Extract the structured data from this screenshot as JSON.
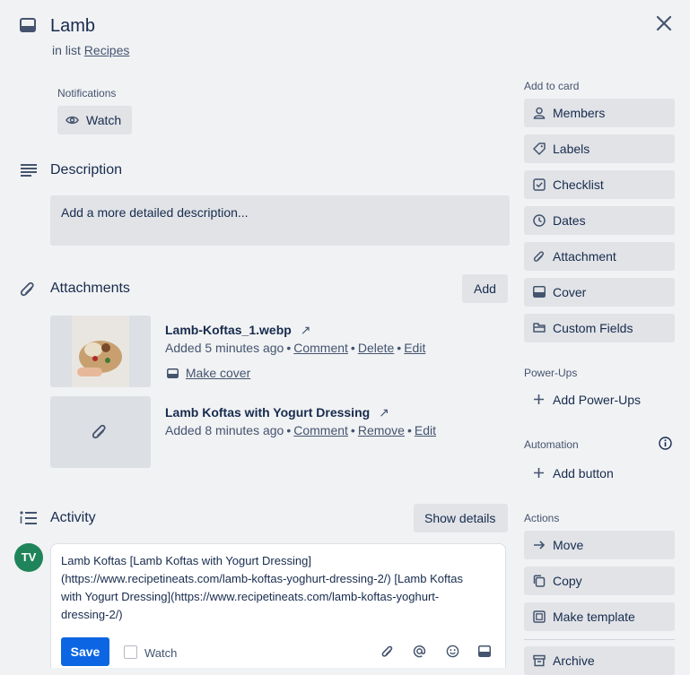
{
  "card": {
    "title": "Lamb",
    "in_list_prefix": "in list",
    "list_name": "Recipes"
  },
  "notifications": {
    "label": "Notifications",
    "watch_label": "Watch"
  },
  "description": {
    "heading": "Description",
    "placeholder": "Add a more detailed description..."
  },
  "attachments": {
    "heading": "Attachments",
    "add_label": "Add",
    "items": [
      {
        "name": "Lamb-Koftas_1.webp",
        "added": "Added 5 minutes ago",
        "actions": [
          "Comment",
          "Delete",
          "Edit"
        ],
        "make_cover": "Make cover"
      },
      {
        "name": "Lamb Koftas with Yogurt Dressing",
        "added": "Added 8 minutes ago",
        "actions": [
          "Comment",
          "Remove",
          "Edit"
        ]
      }
    ]
  },
  "activity": {
    "heading": "Activity",
    "show_details": "Show details",
    "avatar_initials": "TV",
    "comment_text": "Lamb Koftas [Lamb Koftas with Yogurt Dressing](https://www.recipetineats.com/lamb-koftas-yoghurt-dressing-2/) [Lamb Koftas with Yogurt Dressing](https://www.recipetineats.com/lamb-koftas-yoghurt-dressing-2/)",
    "save_label": "Save",
    "watch_label": "Watch"
  },
  "sidebar": {
    "add_to_card_label": "Add to card",
    "add_to_card": [
      "Members",
      "Labels",
      "Checklist",
      "Dates",
      "Attachment",
      "Cover",
      "Custom Fields"
    ],
    "power_ups_label": "Power-Ups",
    "add_power_ups": "Add Power-Ups",
    "automation_label": "Automation",
    "add_button": "Add button",
    "actions_label": "Actions",
    "actions": [
      "Move",
      "Copy",
      "Make template",
      "Archive"
    ]
  },
  "colors": {
    "primary": "#0c66e4",
    "avatar": "#1f845a",
    "panel": "#f1f2f4",
    "button": "#e1e3e7"
  }
}
